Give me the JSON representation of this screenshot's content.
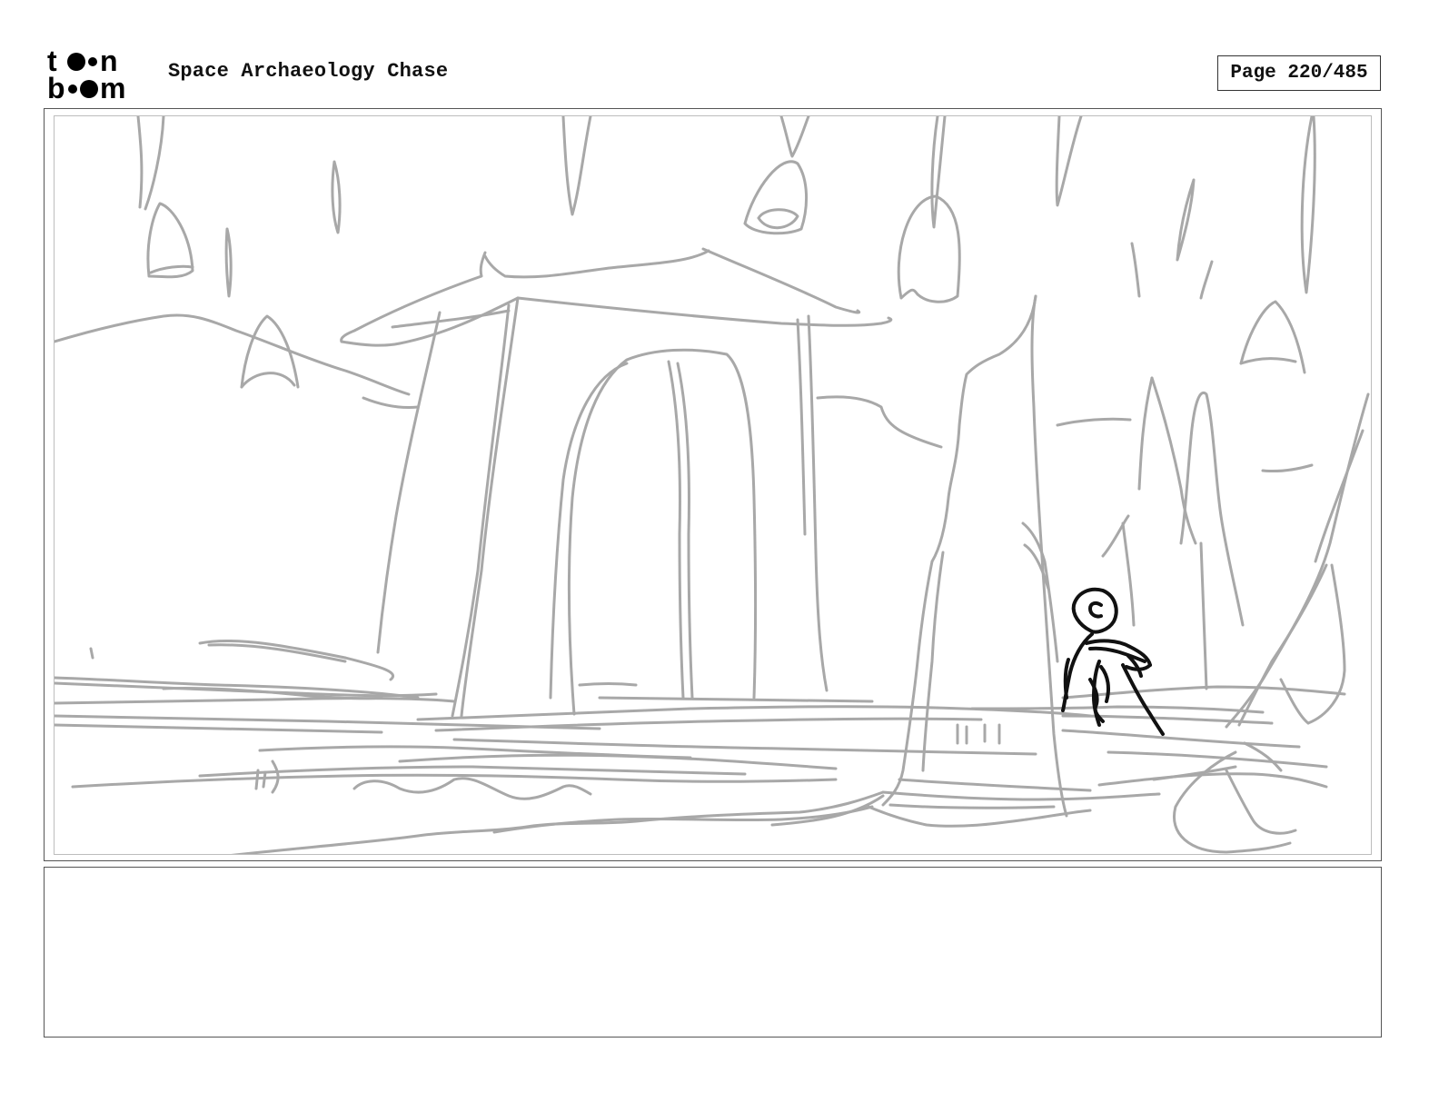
{
  "header": {
    "logo_top": "to•n",
    "logo_bottom": "b••m",
    "project_title": "Space Archaeology Chase",
    "page_label": "Page 220/485"
  },
  "panel": {
    "sketch_subject": "stone archway",
    "line_color": "#a8a8a8",
    "character_color": "#111111"
  },
  "notes": {
    "text": ""
  }
}
